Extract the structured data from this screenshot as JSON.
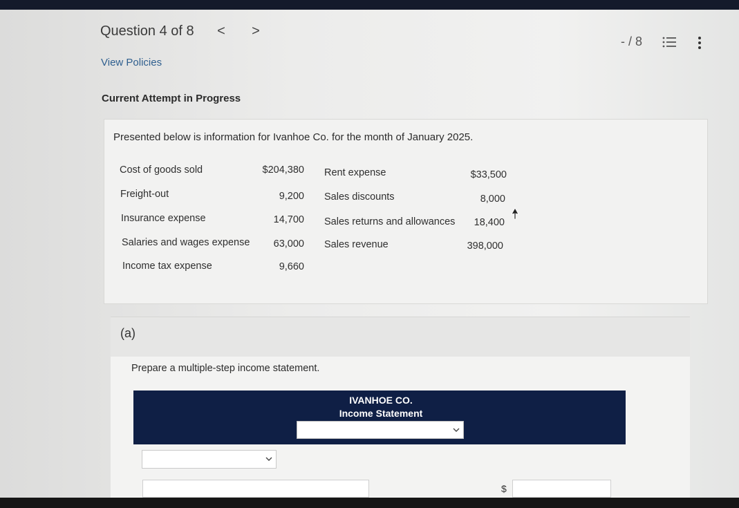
{
  "header": {
    "question_title": "Question 4 of 8",
    "prev_glyph": "<",
    "next_glyph": ">",
    "score": "- / 8",
    "list_icon": "list-icon",
    "more_icon": "vertical-ellipsis-icon"
  },
  "links": {
    "view_policies": "View Policies"
  },
  "attempt_status": "Current Attempt in Progress",
  "problem": {
    "intro": "Presented below is information for Ivanhoe Co. for the month of January 2025.",
    "left_items": [
      {
        "label": "Cost of goods sold",
        "amount": "$204,380"
      },
      {
        "label": "Freight-out",
        "amount": "9,200"
      },
      {
        "label": "Insurance expense",
        "amount": "14,700"
      },
      {
        "label": "Salaries and wages expense",
        "amount": "63,000"
      },
      {
        "label": "Income tax expense",
        "amount": "9,660"
      }
    ],
    "right_items": [
      {
        "label": "Rent expense",
        "amount": "$33,500"
      },
      {
        "label": "Sales discounts",
        "amount": "8,000"
      },
      {
        "label": "Sales returns and allowances",
        "amount": "18,400"
      },
      {
        "label": "Sales revenue",
        "amount": "398,000"
      }
    ]
  },
  "part": {
    "label": "(a)",
    "instruction": "Prepare a multiple-step income statement."
  },
  "statement": {
    "company": "IVANHOE CO.",
    "title": "Income Statement",
    "period_value": "",
    "first_line_value": "",
    "dollar_sign": "$"
  },
  "colors": {
    "header_navy": "#0f1f45",
    "top_bar": "#141a2b",
    "link_blue": "#2f5f8f"
  }
}
